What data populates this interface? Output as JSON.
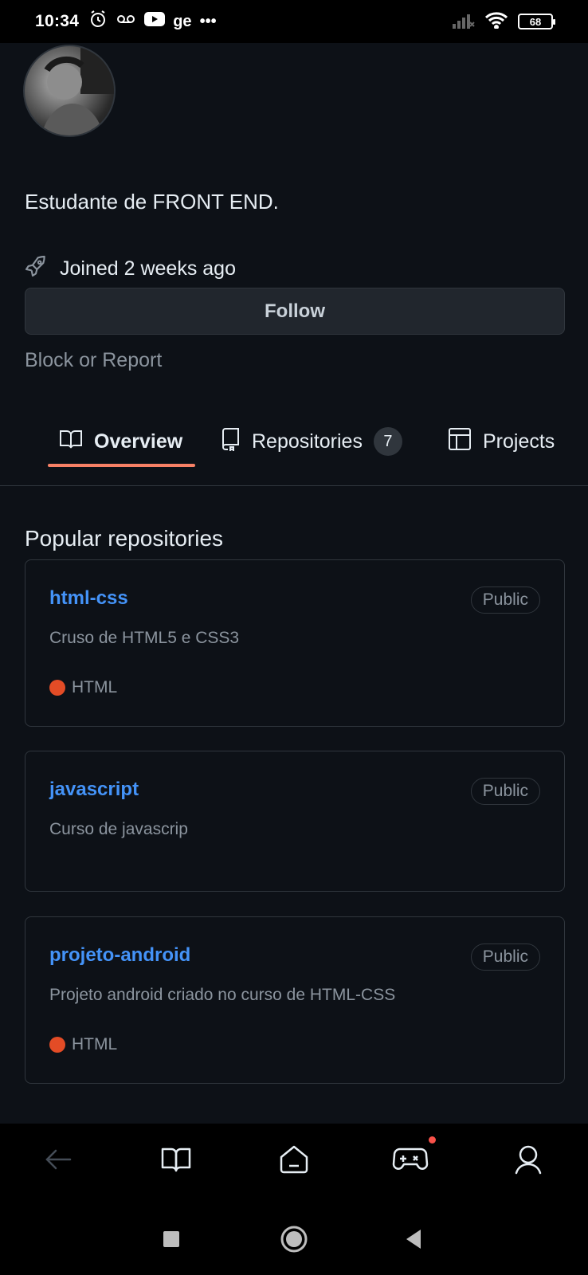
{
  "status_bar": {
    "time": "10:34",
    "app_text": "ge",
    "more": "•••",
    "battery": "68"
  },
  "profile": {
    "bio": "Estudante de FRONT END.",
    "joined": "Joined 2 weeks ago",
    "follow_label": "Follow",
    "block_label": "Block or Report"
  },
  "tabs": [
    {
      "label": "Overview",
      "icon": "book-icon",
      "active": true
    },
    {
      "label": "Repositories",
      "icon": "repo-icon",
      "count": "7"
    },
    {
      "label": "Projects",
      "icon": "table-icon"
    }
  ],
  "section": {
    "title": "Popular repositories"
  },
  "repos": [
    {
      "name": "html-css",
      "visibility": "Public",
      "description": "Cruso de HTML5 e CSS3",
      "language": "HTML",
      "language_color": "#e34c26"
    },
    {
      "name": "javascript",
      "visibility": "Public",
      "description": "Curso de javascrip"
    },
    {
      "name": "projeto-android",
      "visibility": "Public",
      "description": "Projeto android criado no curso de HTML-CSS",
      "language": "HTML",
      "language_color": "#e34c26"
    }
  ],
  "colors": {
    "background": "#0d1117",
    "link": "#4493f8",
    "tab_underline": "#f78166",
    "notification": "#f85149"
  }
}
